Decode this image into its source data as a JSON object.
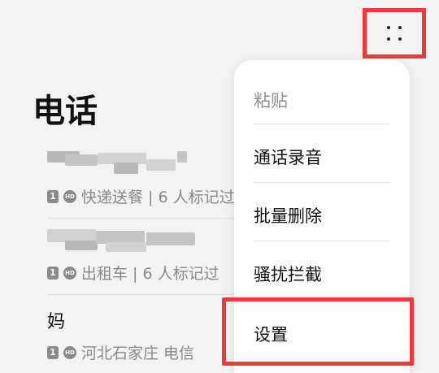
{
  "page": {
    "title": "电话"
  },
  "call_log": [
    {
      "sim": "1",
      "hd": "HD",
      "subtitle": "快递送餐 | 6 人标记过"
    },
    {
      "sim": "1",
      "hd": "HD",
      "subtitle": "出租车 | 6 人标记过"
    },
    {
      "name": "妈",
      "sim": "1",
      "hd": "HD",
      "subtitle": "河北石家庄 电信"
    }
  ],
  "toolbar": {
    "more_icon": "more-dots-icon"
  },
  "menu": {
    "items": [
      {
        "label": "粘贴",
        "enabled": false
      },
      {
        "label": "通话录音",
        "enabled": true
      },
      {
        "label": "批量删除",
        "enabled": true
      },
      {
        "label": "骚扰拦截",
        "enabled": true
      },
      {
        "label": "设置",
        "enabled": true
      }
    ]
  },
  "colors": {
    "highlight": "#ef3a3a",
    "background": "#f3f3f3",
    "menu_bg": "#ffffff"
  }
}
